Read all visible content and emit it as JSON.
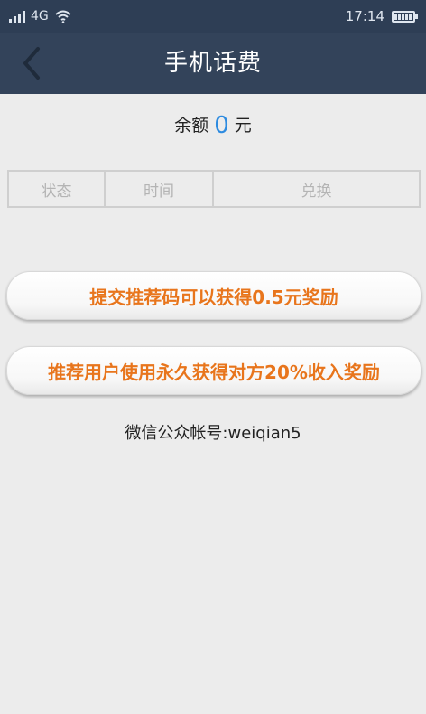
{
  "status_bar": {
    "network": "4G",
    "time": "17:14"
  },
  "header": {
    "title": "手机话费"
  },
  "balance": {
    "label": "余额",
    "value": "0",
    "unit": "元"
  },
  "table": {
    "columns": [
      "状态",
      "时间",
      "兑换"
    ]
  },
  "actions": {
    "submit_referral_label": "提交推荐码可以获得0.5元奖励",
    "referral_reward_label": "推荐用户使用永久获得对方20%收入奖励"
  },
  "footer": {
    "wechat_text": "微信公众帐号:weiqian5"
  },
  "colors": {
    "status_bar": "#2e3e55",
    "title_bar": "#33435a",
    "accent_orange": "#e8751c",
    "balance_blue": "#2d8be0"
  }
}
